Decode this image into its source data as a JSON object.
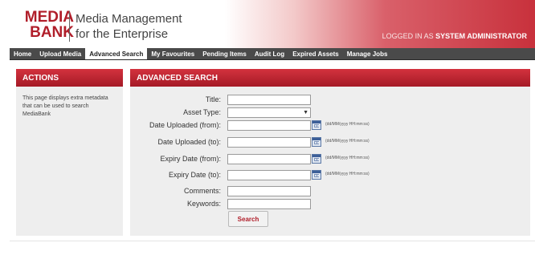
{
  "brand": {
    "logo_line1": "MEDIA",
    "logo_line2": "BANK",
    "tagline_line1": "Media Management",
    "tagline_line2": "for the Enterprise",
    "logged_in_prefix": "LOGGED IN AS",
    "logged_in_user": "SYSTEM ADMINISTRATOR",
    "accent_color": "#b01e2a"
  },
  "nav": {
    "items": [
      {
        "label": "Home",
        "active": false
      },
      {
        "label": "Upload Media",
        "active": false
      },
      {
        "label": "Advanced Search",
        "active": true
      },
      {
        "label": "My Favourites",
        "active": false
      },
      {
        "label": "Pending Items",
        "active": false
      },
      {
        "label": "Audit Log",
        "active": false
      },
      {
        "label": "Expired Assets",
        "active": false
      },
      {
        "label": "Manage Jobs",
        "active": false
      }
    ]
  },
  "actions": {
    "title": "ACTIONS",
    "description": "This page displays extra metadata that can be used to search MediaBank"
  },
  "search": {
    "title": "ADVANCED SEARCH",
    "fields": {
      "title": {
        "label": "Title:",
        "value": ""
      },
      "asset_type": {
        "label": "Asset Type:",
        "value": ""
      },
      "date_uploaded_from": {
        "label": "Date Uploaded (from):",
        "value": ""
      },
      "date_uploaded_to": {
        "label": "Date Uploaded (to):",
        "value": ""
      },
      "expiry_date_from": {
        "label": "Expiry Date (from):",
        "value": ""
      },
      "expiry_date_to": {
        "label": "Expiry Date (to):",
        "value": ""
      },
      "comments": {
        "label": "Comments:",
        "value": ""
      },
      "keywords": {
        "label": "Keywords:",
        "value": ""
      }
    },
    "date_format_hint": "(dd/MM/yyyy HH:mm:ss)",
    "search_button": "Search"
  }
}
